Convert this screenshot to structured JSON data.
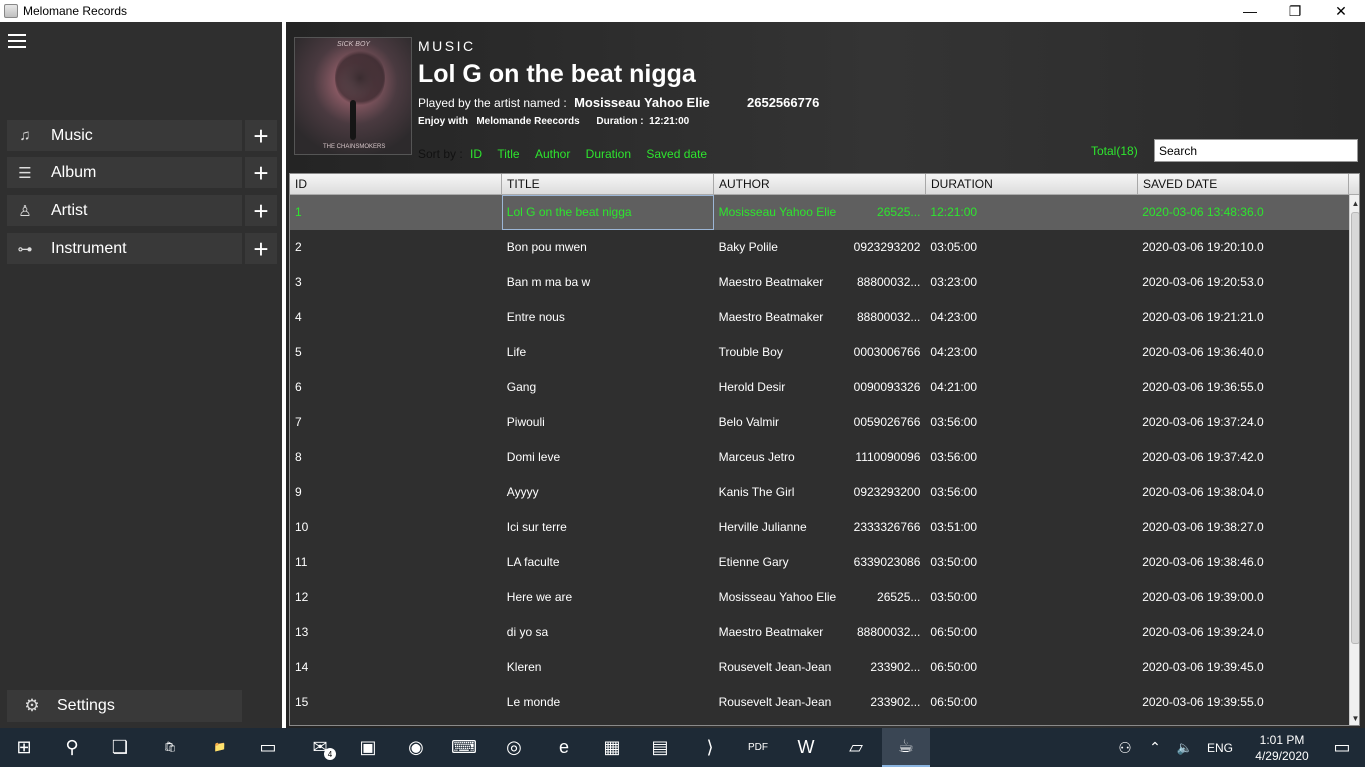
{
  "window": {
    "title": "Melomane Records",
    "minimize_icon": "minimize-icon",
    "maximize_icon": "restore-icon",
    "close_icon": "close-icon",
    "min_glyph": "—",
    "max_glyph": "❐",
    "close_glyph": "✕"
  },
  "sidebar": {
    "items": [
      {
        "label": "Music",
        "icon": "music-note-icon",
        "glyph": "♫"
      },
      {
        "label": "Album",
        "icon": "album-list-icon",
        "glyph": "☰"
      },
      {
        "label": "Artist",
        "icon": "person-icon",
        "glyph": "♙"
      },
      {
        "label": "Instrument",
        "icon": "trumpet-icon",
        "glyph": "⊶"
      }
    ],
    "plus_glyph": "+",
    "settings_label": "Settings",
    "settings_glyph": "⚙"
  },
  "header": {
    "section": "MUSIC",
    "title": "Lol G on the beat nigga",
    "played_by_prefix": "Played by the artist named :",
    "artist": "Mosisseau Yahoo Elie",
    "artist_phone": "2652566776",
    "enjoy_with_prefix": "Enjoy with",
    "label": "Melomande Reecords",
    "duration_prefix": "Duration :",
    "duration": "12:21:00",
    "cover_text_top": "SICK BOY",
    "cover_text_bottom": "THE CHAINSMOKERS"
  },
  "sort": {
    "label": "Sort by :",
    "options": [
      "ID",
      "Title",
      "Author",
      "Duration",
      "Saved date"
    ]
  },
  "total": "Total(18)",
  "search": {
    "value": "Search",
    "placeholder": "Search"
  },
  "table": {
    "columns": [
      "ID",
      "TITLE",
      "AUTHOR",
      "DURATION",
      "SAVED DATE"
    ],
    "rows": [
      {
        "id": "1",
        "title": "Lol G on the beat nigga",
        "author": "Mosisseau Yahoo Elie",
        "phone": "26525...",
        "duration": "12:21:00",
        "saved": "2020-03-06 13:48:36.0"
      },
      {
        "id": "2",
        "title": "Bon pou mwen",
        "author": "Baky Polile",
        "phone": "0923293202",
        "duration": "03:05:00",
        "saved": "2020-03-06 19:20:10.0"
      },
      {
        "id": "3",
        "title": "Ban m ma ba w",
        "author": "Maestro Beatmaker",
        "phone": "88800032...",
        "duration": "03:23:00",
        "saved": "2020-03-06 19:20:53.0"
      },
      {
        "id": "4",
        "title": "Entre nous",
        "author": "Maestro Beatmaker",
        "phone": "88800032...",
        "duration": "04:23:00",
        "saved": "2020-03-06 19:21:21.0"
      },
      {
        "id": "5",
        "title": "Life",
        "author": "Trouble  Boy",
        "phone": "0003006766",
        "duration": "04:23:00",
        "saved": "2020-03-06 19:36:40.0"
      },
      {
        "id": "6",
        "title": "Gang",
        "author": "Herold Desir",
        "phone": "0090093326",
        "duration": "04:21:00",
        "saved": "2020-03-06 19:36:55.0"
      },
      {
        "id": "7",
        "title": "Piwouli",
        "author": "Belo Valmir",
        "phone": "0059026766",
        "duration": "03:56:00",
        "saved": "2020-03-06 19:37:24.0"
      },
      {
        "id": "8",
        "title": "Domi leve",
        "author": "Marceus Jetro",
        "phone": "1110090096",
        "duration": "03:56:00",
        "saved": "2020-03-06 19:37:42.0"
      },
      {
        "id": "9",
        "title": "Ayyyy",
        "author": "Kanis The Girl",
        "phone": "0923293200",
        "duration": "03:56:00",
        "saved": "2020-03-06 19:38:04.0"
      },
      {
        "id": "10",
        "title": "Ici sur terre",
        "author": "Herville Julianne",
        "phone": "2333326766",
        "duration": "03:51:00",
        "saved": "2020-03-06 19:38:27.0"
      },
      {
        "id": "11",
        "title": "LA faculte",
        "author": "Etienne Gary",
        "phone": "6339023086",
        "duration": "03:50:00",
        "saved": "2020-03-06 19:38:46.0"
      },
      {
        "id": "12",
        "title": "Here we are",
        "author": "Mosisseau Yahoo Elie",
        "phone": "26525...",
        "duration": "03:50:00",
        "saved": "2020-03-06 19:39:00.0"
      },
      {
        "id": "13",
        "title": "di yo sa",
        "author": "Maestro Beatmaker",
        "phone": "88800032...",
        "duration": "06:50:00",
        "saved": "2020-03-06 19:39:24.0"
      },
      {
        "id": "14",
        "title": "Kleren",
        "author": "Rousevelt Jean-Jean",
        "phone": "233902...",
        "duration": "06:50:00",
        "saved": "2020-03-06 19:39:45.0"
      },
      {
        "id": "15",
        "title": "Le monde",
        "author": "Rousevelt Jean-Jean",
        "phone": "233902...",
        "duration": "06:50:00",
        "saved": "2020-03-06 19:39:55.0"
      }
    ]
  },
  "taskbar": {
    "apps": [
      {
        "name": "start-icon",
        "glyph": "⊞"
      },
      {
        "name": "search-icon",
        "glyph": "⚲"
      },
      {
        "name": "task-view-icon",
        "glyph": "❏"
      },
      {
        "name": "store-icon",
        "glyph": "🛍"
      },
      {
        "name": "file-explorer-icon",
        "glyph": "📁"
      },
      {
        "name": "terminal-icon",
        "glyph": "▭"
      },
      {
        "name": "mail-icon",
        "glyph": "✉"
      },
      {
        "name": "app-icon",
        "glyph": "▣"
      },
      {
        "name": "firefox-icon",
        "glyph": "◉"
      },
      {
        "name": "network-app-icon",
        "glyph": "⌨"
      },
      {
        "name": "chrome-icon",
        "glyph": "◎"
      },
      {
        "name": "edge-icon",
        "glyph": "e"
      },
      {
        "name": "calculator-icon",
        "glyph": "▦"
      },
      {
        "name": "books-icon",
        "glyph": "▤"
      },
      {
        "name": "vscode-icon",
        "glyph": "⟩"
      },
      {
        "name": "pdf-icon",
        "glyph": "PDF"
      },
      {
        "name": "word-icon",
        "glyph": "W"
      },
      {
        "name": "notepad-icon",
        "glyph": "▱"
      },
      {
        "name": "java-icon",
        "glyph": "☕"
      }
    ],
    "mail_badge": "4",
    "tray_people_glyph": "⚇",
    "tray_chevron_glyph": "⌃",
    "tray_volume_glyph": "🔈",
    "language": "ENG",
    "time": "1:01 PM",
    "date": "4/29/2020",
    "notification_glyph": "▭"
  }
}
